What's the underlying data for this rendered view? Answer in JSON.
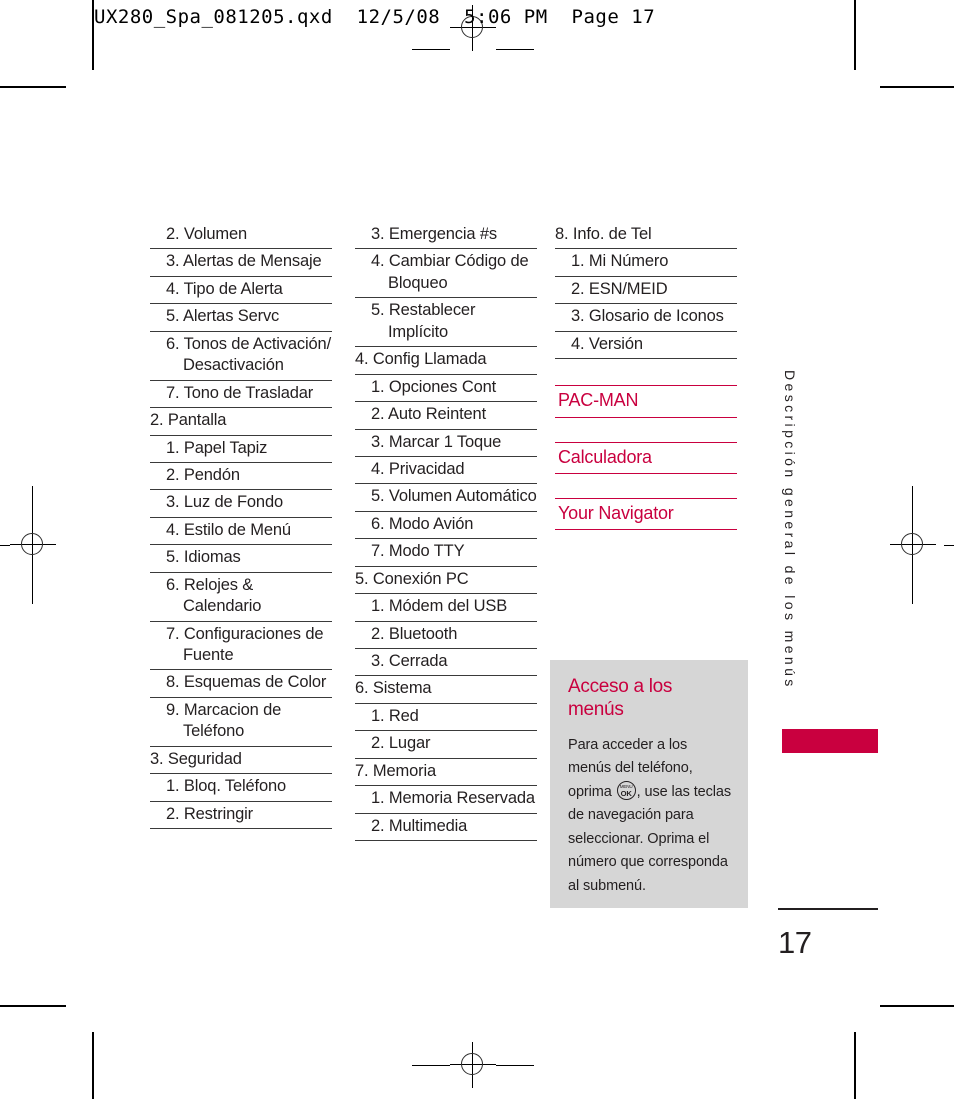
{
  "print_header": "UX280_Spa_081205.qxd  12/5/08  5:06 PM  Page 17",
  "columns": [
    {
      "id": "column-1",
      "items": [
        {
          "text": "2. Volumen",
          "level": 2
        },
        {
          "text": "3. Alertas de Mensaje",
          "level": 2
        },
        {
          "text": "4. Tipo de Alerta",
          "level": 2
        },
        {
          "text": "5. Alertas Servc",
          "level": 2
        },
        {
          "text": "6. Tonos de Activación/ Desactivación",
          "level": 2
        },
        {
          "text": "7.  Tono de Trasladar",
          "level": 2
        },
        {
          "text": "2. Pantalla",
          "level": 1
        },
        {
          "text": "1. Papel Tapiz",
          "level": 2
        },
        {
          "text": "2. Pendón",
          "level": 2
        },
        {
          "text": "3. Luz de Fondo",
          "level": 2
        },
        {
          "text": "4. Estilo de Menú",
          "level": 2
        },
        {
          "text": "5. Idiomas",
          "level": 2
        },
        {
          "text": "6. Relojes & Calendario",
          "level": 2
        },
        {
          "text": "7. Configuraciones de Fuente",
          "level": 2
        },
        {
          "text": "8. Esquemas de Color",
          "level": 2
        },
        {
          "text": "9.  Marcacion de Teléfono",
          "level": 2
        },
        {
          "text": "3. Seguridad",
          "level": 1
        },
        {
          "text": "1.  Bloq. Teléfono",
          "level": 2
        },
        {
          "text": "2.  Restringir",
          "level": 2
        }
      ]
    },
    {
      "id": "column-2",
      "items": [
        {
          "text": "3.  Emergencia #s",
          "level": 2
        },
        {
          "text": "4.  Cambiar Código de Bloqueo",
          "level": 2
        },
        {
          "text": "5.  Restablecer Implícito",
          "level": 2
        },
        {
          "text": "4. Config Llamada",
          "level": 1
        },
        {
          "text": "1. Opciones Cont",
          "level": 2
        },
        {
          "text": "2. Auto Reintent",
          "level": 2
        },
        {
          "text": "3. Marcar 1 Toque",
          "level": 2
        },
        {
          "text": "4. Privacidad",
          "level": 2
        },
        {
          "text": "5. Volumen Automático",
          "level": 2
        },
        {
          "text": "6. Modo Avión",
          "level": 2
        },
        {
          "text": "7. Modo TTY",
          "level": 2
        },
        {
          "text": "5. Conexión PC",
          "level": 1
        },
        {
          "text": "1.  Módem del USB",
          "level": 2
        },
        {
          "text": "2.  Bluetooth",
          "level": 2
        },
        {
          "text": "3.  Cerrada",
          "level": 2
        },
        {
          "text": "6. Sistema",
          "level": 1
        },
        {
          "text": "1. Red",
          "level": 2
        },
        {
          "text": "2. Lugar",
          "level": 2
        },
        {
          "text": "7. Memoria",
          "level": 1
        },
        {
          "text": "1. Memoria Reservada",
          "level": 2
        },
        {
          "text": "2. Multimedia",
          "level": 2
        }
      ]
    },
    {
      "id": "column-3",
      "items": [
        {
          "text": "8. Info. de Tel",
          "level": 1
        },
        {
          "text": "1.  Mi Número",
          "level": 2
        },
        {
          "text": "2.  ESN/MEID",
          "level": 2
        },
        {
          "text": "3.  Glosario de Iconos",
          "level": 2
        },
        {
          "text": "4.  Versión",
          "level": 2
        }
      ],
      "apps": [
        {
          "text": "PAC-MAN"
        },
        {
          "text": "Calculadora"
        },
        {
          "text": "Your Navigator"
        }
      ]
    }
  ],
  "info_box": {
    "title": "Acceso a los menús",
    "body_part_1": "Para acceder a los menús del teléfono, oprima",
    "icon_top": "MENU",
    "icon_bottom": "OK",
    "body_part_2": ", use las teclas de navegación para seleccionar. Oprima el número que corresponda al submenú."
  },
  "side_running_head": "Descripción general de los menús",
  "page_number": "17",
  "colors": {
    "accent": "#c9003f",
    "text": "#231f20",
    "info_box_bg": "#d6d6d6"
  }
}
